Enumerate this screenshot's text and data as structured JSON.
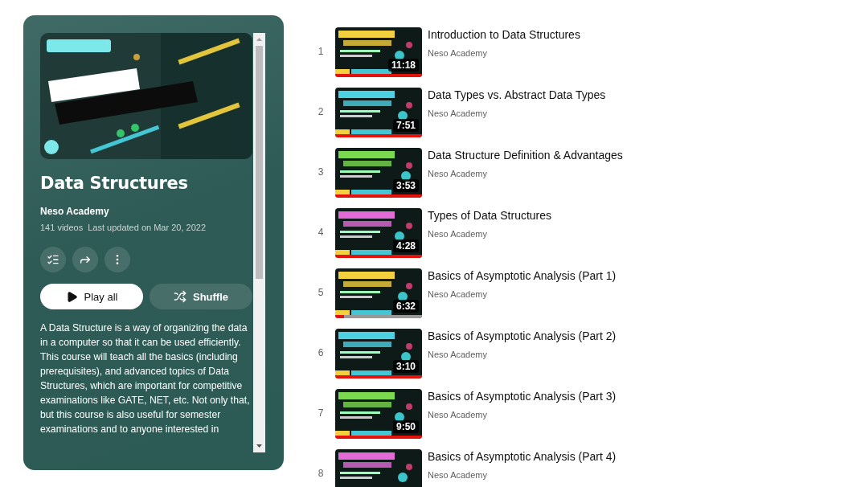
{
  "playlist": {
    "title": "Data Structures",
    "channel": "Neso Academy",
    "video_count": "141 videos",
    "updated": "Last updated on Mar 20, 2022",
    "play_button": "Play all",
    "shuffle_button": "Shuffle",
    "description": [
      "A Data Structure is a way of organizing the data in a computer so that it can be used efficiently.",
      "This course will teach all the basics (including prerequisites), and advanced topics of Data Structures, which are important for competitive examinations like GATE, NET, etc. Not only that, but this course is also useful for semester examinations and to anyone interested in"
    ]
  },
  "videos": [
    {
      "index": "1",
      "title": "Introduction to Data Structures",
      "channel": "Neso Academy",
      "duration": "11:18",
      "level": 1
    },
    {
      "index": "2",
      "title": "Data Types vs. Abstract Data Types",
      "channel": "Neso Academy",
      "duration": "7:51",
      "level": 1
    },
    {
      "index": "3",
      "title": "Data Structure Definition & Advantages",
      "channel": "Neso Academy",
      "duration": "3:53",
      "level": 1
    },
    {
      "index": "4",
      "title": "Types of Data Structures",
      "channel": "Neso Academy",
      "duration": "4:28",
      "level": 1
    },
    {
      "index": "5",
      "title": "Basics of Asymptotic Analysis (Part 1)",
      "channel": "Neso Academy",
      "duration": "6:32",
      "level": 0.1
    },
    {
      "index": "6",
      "title": "Basics of Asymptotic Analysis (Part 2)",
      "channel": "Neso Academy",
      "duration": "3:10",
      "level": 1
    },
    {
      "index": "7",
      "title": "Basics of Asymptotic Analysis (Part 3)",
      "channel": "Neso Academy",
      "duration": "9:50",
      "level": 1
    },
    {
      "index": "8",
      "title": "Basics of Asymptotic Analysis (Part 4)",
      "channel": "Neso Academy"
    }
  ]
}
